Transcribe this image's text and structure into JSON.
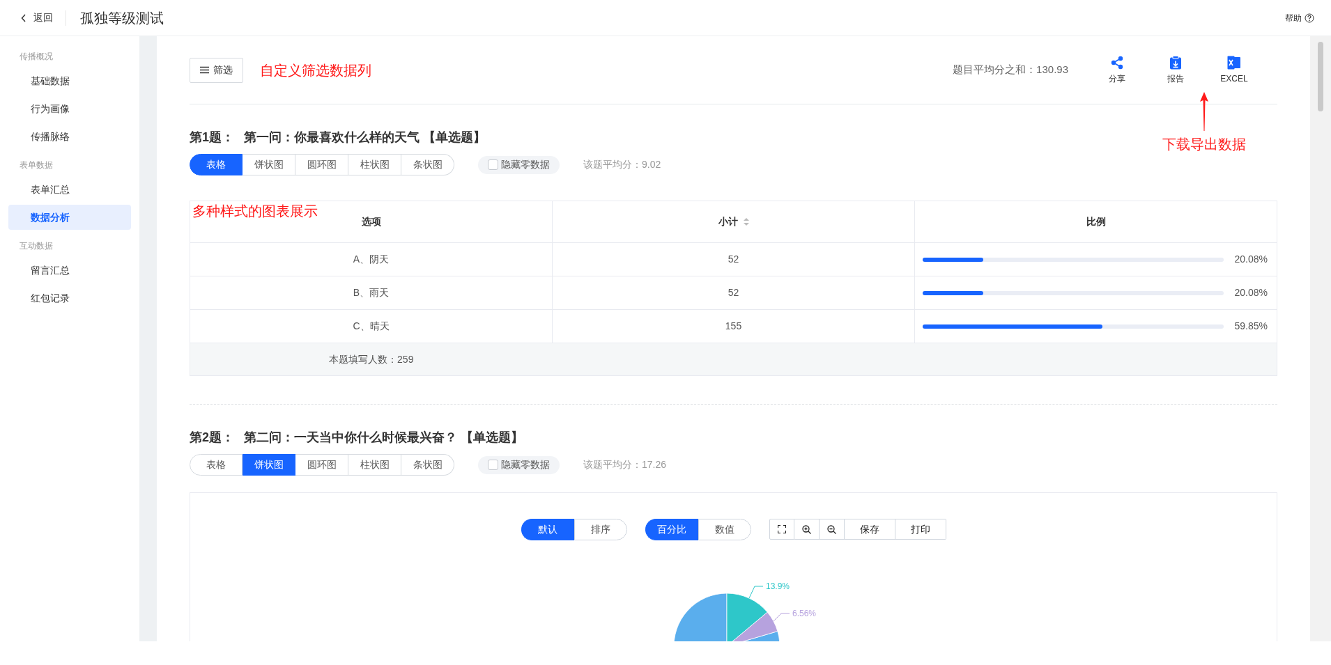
{
  "header": {
    "back": "返回",
    "title": "孤独等级测试",
    "help": "帮助"
  },
  "sidebar": {
    "groups": [
      {
        "title": "传播概况",
        "items": [
          {
            "label": "基础数据",
            "selected": false
          },
          {
            "label": "行为画像",
            "selected": false
          },
          {
            "label": "传播脉络",
            "selected": false
          }
        ]
      },
      {
        "title": "表单数据",
        "items": [
          {
            "label": "表单汇总",
            "selected": false
          },
          {
            "label": "数据分析",
            "selected": true
          }
        ]
      },
      {
        "title": "互动数据",
        "items": [
          {
            "label": "留言汇总",
            "selected": false
          },
          {
            "label": "红包记录",
            "selected": false
          }
        ]
      }
    ]
  },
  "toolbar": {
    "filter_button": "筛选",
    "filter_annotation": "自定义筛选数据列",
    "total_average": "题目平均分之和：130.93",
    "actions": [
      {
        "kind": "share",
        "label": "分享"
      },
      {
        "kind": "report",
        "label": "报告"
      },
      {
        "kind": "excel",
        "label": "EXCEL"
      }
    ],
    "download_annotation": "下载导出数据"
  },
  "questions": [
    {
      "kind": "table",
      "number": "第1题：",
      "title": "第一问：你最喜欢什么样的天气 【单选题】",
      "view_tabs": [
        {
          "label": "表格",
          "selected": true
        },
        {
          "label": "饼状图",
          "selected": false
        },
        {
          "label": "圆环图",
          "selected": false
        },
        {
          "label": "柱状图",
          "selected": false
        },
        {
          "label": "条状图",
          "selected": false
        }
      ],
      "hide_zero": {
        "label": "隐藏零数据",
        "checked": false
      },
      "average": "该题平均分：9.02",
      "annotation": "多种样式的图表展示",
      "table": {
        "columns": [
          {
            "label": "选项",
            "sortable": false
          },
          {
            "label": "小计",
            "sortable": true
          },
          {
            "label": "比例",
            "sortable": false
          }
        ],
        "rows": [
          {
            "option": "A、阴天",
            "count": "52",
            "percent": "20.08%",
            "level": 0.2008
          },
          {
            "option": "B、雨天",
            "count": "52",
            "percent": "20.08%",
            "level": 0.2008
          },
          {
            "option": "C、晴天",
            "count": "155",
            "percent": "59.85%",
            "level": 0.5985
          }
        ],
        "footer": "本题填写人数：259"
      }
    },
    {
      "kind": "chart",
      "number": "第2题：",
      "title": "第二问：一天当中你什么时候最兴奋？ 【单选题】",
      "view_tabs": [
        {
          "label": "表格",
          "selected": false
        },
        {
          "label": "饼状图",
          "selected": true
        },
        {
          "label": "圆环图",
          "selected": false
        },
        {
          "label": "柱状图",
          "selected": false
        },
        {
          "label": "条状图",
          "selected": false
        }
      ],
      "hide_zero": {
        "label": "隐藏零数据",
        "checked": false
      },
      "average": "该题平均分：17.26",
      "controls": {
        "order": [
          {
            "label": "默认",
            "selected": true
          },
          {
            "label": "排序",
            "selected": false
          }
        ],
        "mode": [
          {
            "label": "百分比",
            "selected": true
          },
          {
            "label": "数值",
            "selected": false
          }
        ],
        "tools": [
          {
            "kind": "fullscreen"
          },
          {
            "kind": "zoom-in"
          },
          {
            "kind": "zoom-out"
          },
          {
            "kind": "text",
            "label": "保存"
          },
          {
            "kind": "text",
            "label": "打印"
          }
        ]
      },
      "pie": {
        "labels": [
          {
            "text": "13.9%",
            "color": "#2ec7c9"
          },
          {
            "text": "6.56%",
            "color": "#b6a2de"
          }
        ]
      }
    }
  ]
}
